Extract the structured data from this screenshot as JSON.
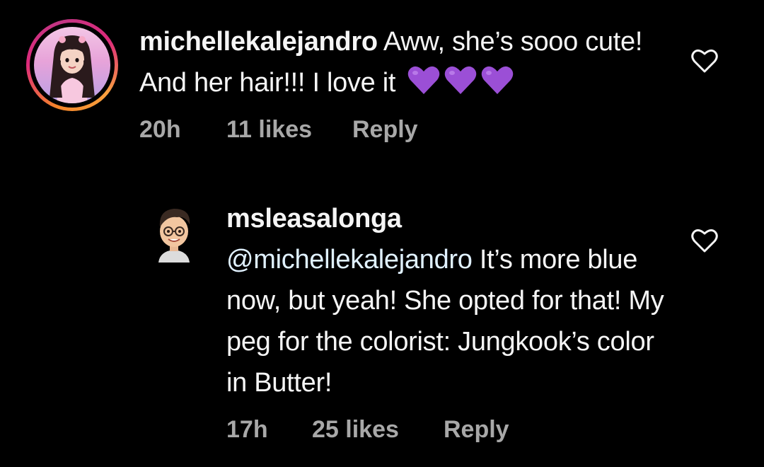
{
  "comments": [
    {
      "username": "michellekalejandro",
      "text": " Aww, she’s sooo cute! And her hair!!! I love it",
      "emoji": "purple-heart x3",
      "time": "20h",
      "likes": "11 likes",
      "reply_label": "Reply",
      "avatar": "profile-photo-with-story-ring",
      "like_icon": "heart-outline-icon"
    },
    {
      "username": "msleasalonga",
      "mention": "@michellekalejandro",
      "text": " It’s more blue now, but yeah! She opted for that! My peg for the colorist: Jungkook’s color in Butter!",
      "time": "17h",
      "likes": "25 likes",
      "reply_label": "Reply",
      "avatar": "bitmoji-avatar",
      "like_icon": "heart-outline-icon"
    }
  ],
  "colors": {
    "background": "#000000",
    "text": "#f5f5f5",
    "meta": "#a8a8a8",
    "emoji": "#9b4fd6",
    "ring_start": "#f58529",
    "ring_end": "#dd2a7b"
  }
}
